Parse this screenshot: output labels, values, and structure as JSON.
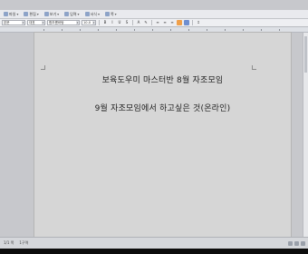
{
  "menu": {
    "items": [
      {
        "label": "파일"
      },
      {
        "label": "편집"
      },
      {
        "label": "보기"
      },
      {
        "label": "입력"
      },
      {
        "label": "서식"
      },
      {
        "label": "쪽"
      }
    ]
  },
  "toolbar": {
    "style_value": "본문",
    "lang_value": "대표",
    "font_value": "함초롬바탕",
    "size_value": "10.0"
  },
  "document": {
    "line1": "보육도우미 마스터반 8월 자조모임",
    "line2": "9월 자조모임에서 하고싶은 것(온라인)"
  },
  "status": {
    "page": "1/1 쪽",
    "section": "1구역"
  }
}
